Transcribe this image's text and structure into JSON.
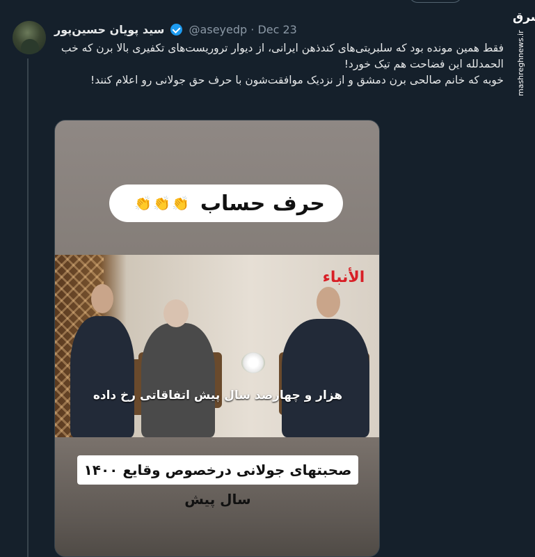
{
  "tweet": {
    "author_name": "سید پویان حسین‌پور",
    "handle": "@aseyedp",
    "separator": "·",
    "date": "Dec 23",
    "text_lines": [
      "فقط همین مونده بود که سلبریتی‌های کندذهن ایرانی، از دیوار تروریست‌های تکفیری بالا برن که خب الحمدلله این فضاحت هم تیک خورد!",
      "خوبه که خانم صالحی برن دمشق و از نزدیک موافقت‌شون با حرف حق جولانی رو اعلام کنند!"
    ]
  },
  "media": {
    "top_pill_text": "حرف حساب",
    "top_pill_emoji": "👏👏👏",
    "news_logo": "الأنباء",
    "scene_caption": "هزار و چهارصد سال پیش اتفاقاتی رخ داده",
    "bottom_banner": "صحبتهای جولانی درخصوص وقایع ۱۴۰۰ سال پیش"
  },
  "watermark": {
    "logo_text": "مشرق",
    "url": "mashreghnews.ir"
  }
}
